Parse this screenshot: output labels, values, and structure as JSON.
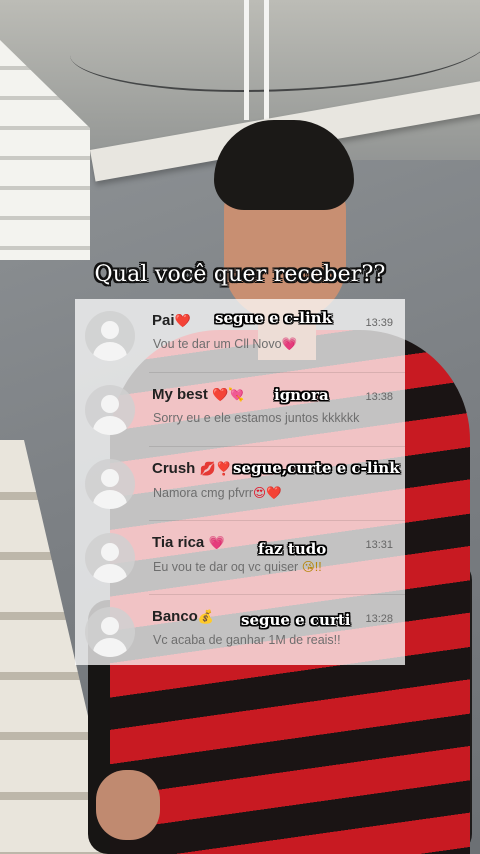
{
  "question": "Qual você quer receber??",
  "chats": [
    {
      "name": "Pai",
      "emoji": "❤️",
      "time": "13:39",
      "preview": "Vou te dar um Cll Novo",
      "preview_emoji": "💗",
      "overlay": "segue e c-link"
    },
    {
      "name": "My best",
      "emoji": "❤️💘",
      "time": "13:38",
      "preview": "Sorry eu e ele estamos juntos kkkkkk",
      "preview_emoji": "",
      "overlay": "ignora"
    },
    {
      "name": "Crush",
      "emoji": "💋❣️",
      "time": "",
      "preview": "Namora cmg pfvrr",
      "preview_emoji": "😍❤️",
      "overlay": "segue,curte e c-link"
    },
    {
      "name": "Tia rica",
      "emoji": "💗",
      "time": "13:31",
      "preview": "Eu vou te dar oq vc quiser",
      "preview_emoji": "😘!!",
      "overlay": "faz tudo"
    },
    {
      "name": "Banco",
      "emoji": "💰",
      "time": "13:28",
      "preview": "Vc acaba de ganhar 1M de reais!!",
      "preview_emoji": "",
      "overlay": "segue e curti"
    }
  ],
  "icons": {
    "avatar": "default-user-avatar-icon"
  }
}
